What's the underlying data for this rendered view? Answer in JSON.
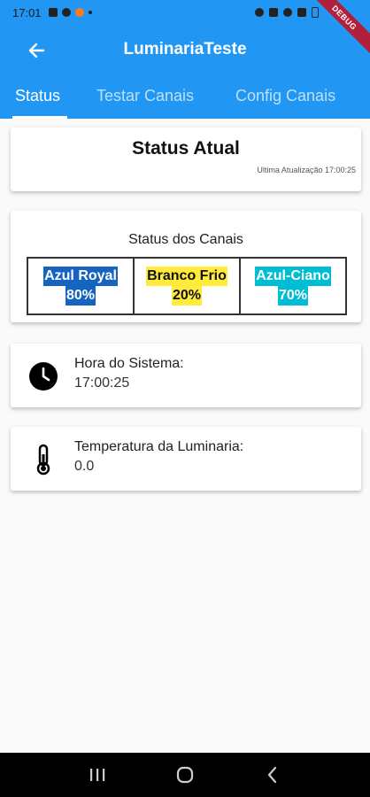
{
  "status_bar": {
    "time": "17:01"
  },
  "debug_banner": "DEBUG",
  "app_bar": {
    "title": "LuminariaTeste"
  },
  "tabs": [
    {
      "label": "Status",
      "active": true
    },
    {
      "label": "Testar Canais",
      "active": false
    },
    {
      "label": "Config Canais",
      "active": false
    }
  ],
  "status_card": {
    "title": "Status Atual",
    "last_update": "Ultima Atualização 17:00:25"
  },
  "channels_card": {
    "title": "Status dos Canais",
    "channels": [
      {
        "name": "Azul Royal",
        "value": "80%",
        "bg": "#1565c0",
        "fg": "#ffffff"
      },
      {
        "name": "Branco Frio",
        "value": "20%",
        "bg": "#ffeb3b",
        "fg": "#111111"
      },
      {
        "name": "Azul-Ciano",
        "value": "70%",
        "bg": "#00bcd4",
        "fg": "#ffffff"
      }
    ]
  },
  "system_time_card": {
    "icon": "clock-icon",
    "label": "Hora do Sistema:",
    "value": "17:00:25"
  },
  "temperature_card": {
    "icon": "thermometer-icon",
    "label": "Temperatura da Luminaria:",
    "value": "0.0"
  },
  "colors": {
    "primary": "#2196f3",
    "background": "#fafafa"
  }
}
